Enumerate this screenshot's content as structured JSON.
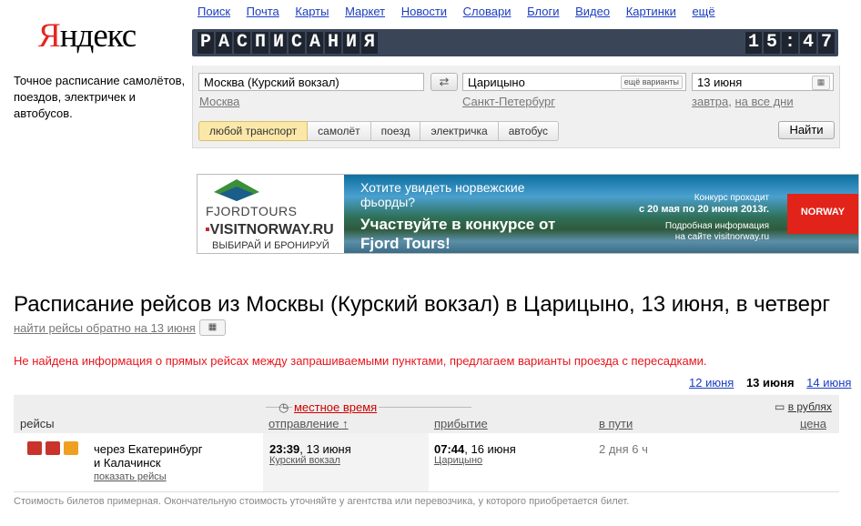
{
  "nav": [
    "Поиск",
    "Почта",
    "Карты",
    "Маркет",
    "Новости",
    "Словари",
    "Блоги",
    "Видео",
    "Картинки",
    "ещё"
  ],
  "logo": {
    "first": "Я",
    "rest": "ндекс"
  },
  "tagline": "Точное расписание самолётов, поездов, электричек и автобусов.",
  "header": {
    "title_tiles": [
      "Р",
      "А",
      "С",
      "П",
      "И",
      "С",
      "А",
      "Н",
      "И",
      "Я"
    ],
    "clock_tiles": [
      "1",
      "5",
      ":",
      "4",
      "7"
    ]
  },
  "search": {
    "from_value": "Москва (Курский вокзал)",
    "from_hint": "Москва",
    "to_value": "Царицыно",
    "to_variants": "ещё варианты",
    "to_hint": "Санкт-Петербург",
    "date_value": "13 июня",
    "date_hint_tomorrow": "завтра",
    "date_hint_all": "на все дни",
    "swap_icon": "⇄",
    "modes": [
      "любой транспорт",
      "самолёт",
      "поезд",
      "электричка",
      "автобус"
    ],
    "find_label": "Найти"
  },
  "banner": {
    "brand": "FJORDTOURS",
    "visit_prefix": "▪",
    "visit": "VISITNORWAY.RU",
    "visit_sub": "ВЫБИРАЙ И БРОНИРУЙ",
    "question": "Хотите увидеть норвежские фьорды?",
    "cta": "Участвуйте в конкурсе от Fjord Tours!",
    "contest": "Конкурс проходит",
    "contest_dates": "с 20 мая по 20 июня 2013г.",
    "info": "Подробная информация на сайте visitnorway.ru",
    "norway": "NORWAY"
  },
  "heading": "Расписание рейсов из Москвы (Курский вокзал) в Царицыно, 13 июня, в четверг",
  "back_link": "найти рейсы обратно на 13 июня",
  "warning": "Не найдена информация о прямых рейсах между запрашиваемыми пунктами, предлагаем варианты проезда с пересадками.",
  "date_nav": {
    "prev": "12 июня",
    "current": "13 июня",
    "next": "14 июня"
  },
  "table": {
    "local_time": "местное время",
    "currency": "в рублях",
    "cols": {
      "trips": "рейсы",
      "departure": "отправление ↑",
      "arrival": "прибытие",
      "travel": "в пути",
      "price": "цена"
    },
    "row": {
      "route_line1": "через Екатеринбург",
      "route_line2": "и Калачинск",
      "show": "показать рейсы",
      "dep_time": "23:39",
      "dep_date": ", 13 июня",
      "dep_station": "Курский вокзал",
      "arr_time": "07:44",
      "arr_date": ", 16 июня",
      "arr_station": "Царицыно",
      "duration": "2 дня 6 ч"
    }
  },
  "footer": "Стоимость билетов примерная. Окончательную стоимость уточняйте у агентства или перевозчика, у которого приобретается билет.",
  "colors": {
    "link": "#1a3dc1",
    "warning": "#e8141c",
    "titlebar": "#3a4658",
    "active_mode": "#fbe8a9",
    "bus_red": "#c8342c",
    "bus_orange": "#f0a020"
  }
}
